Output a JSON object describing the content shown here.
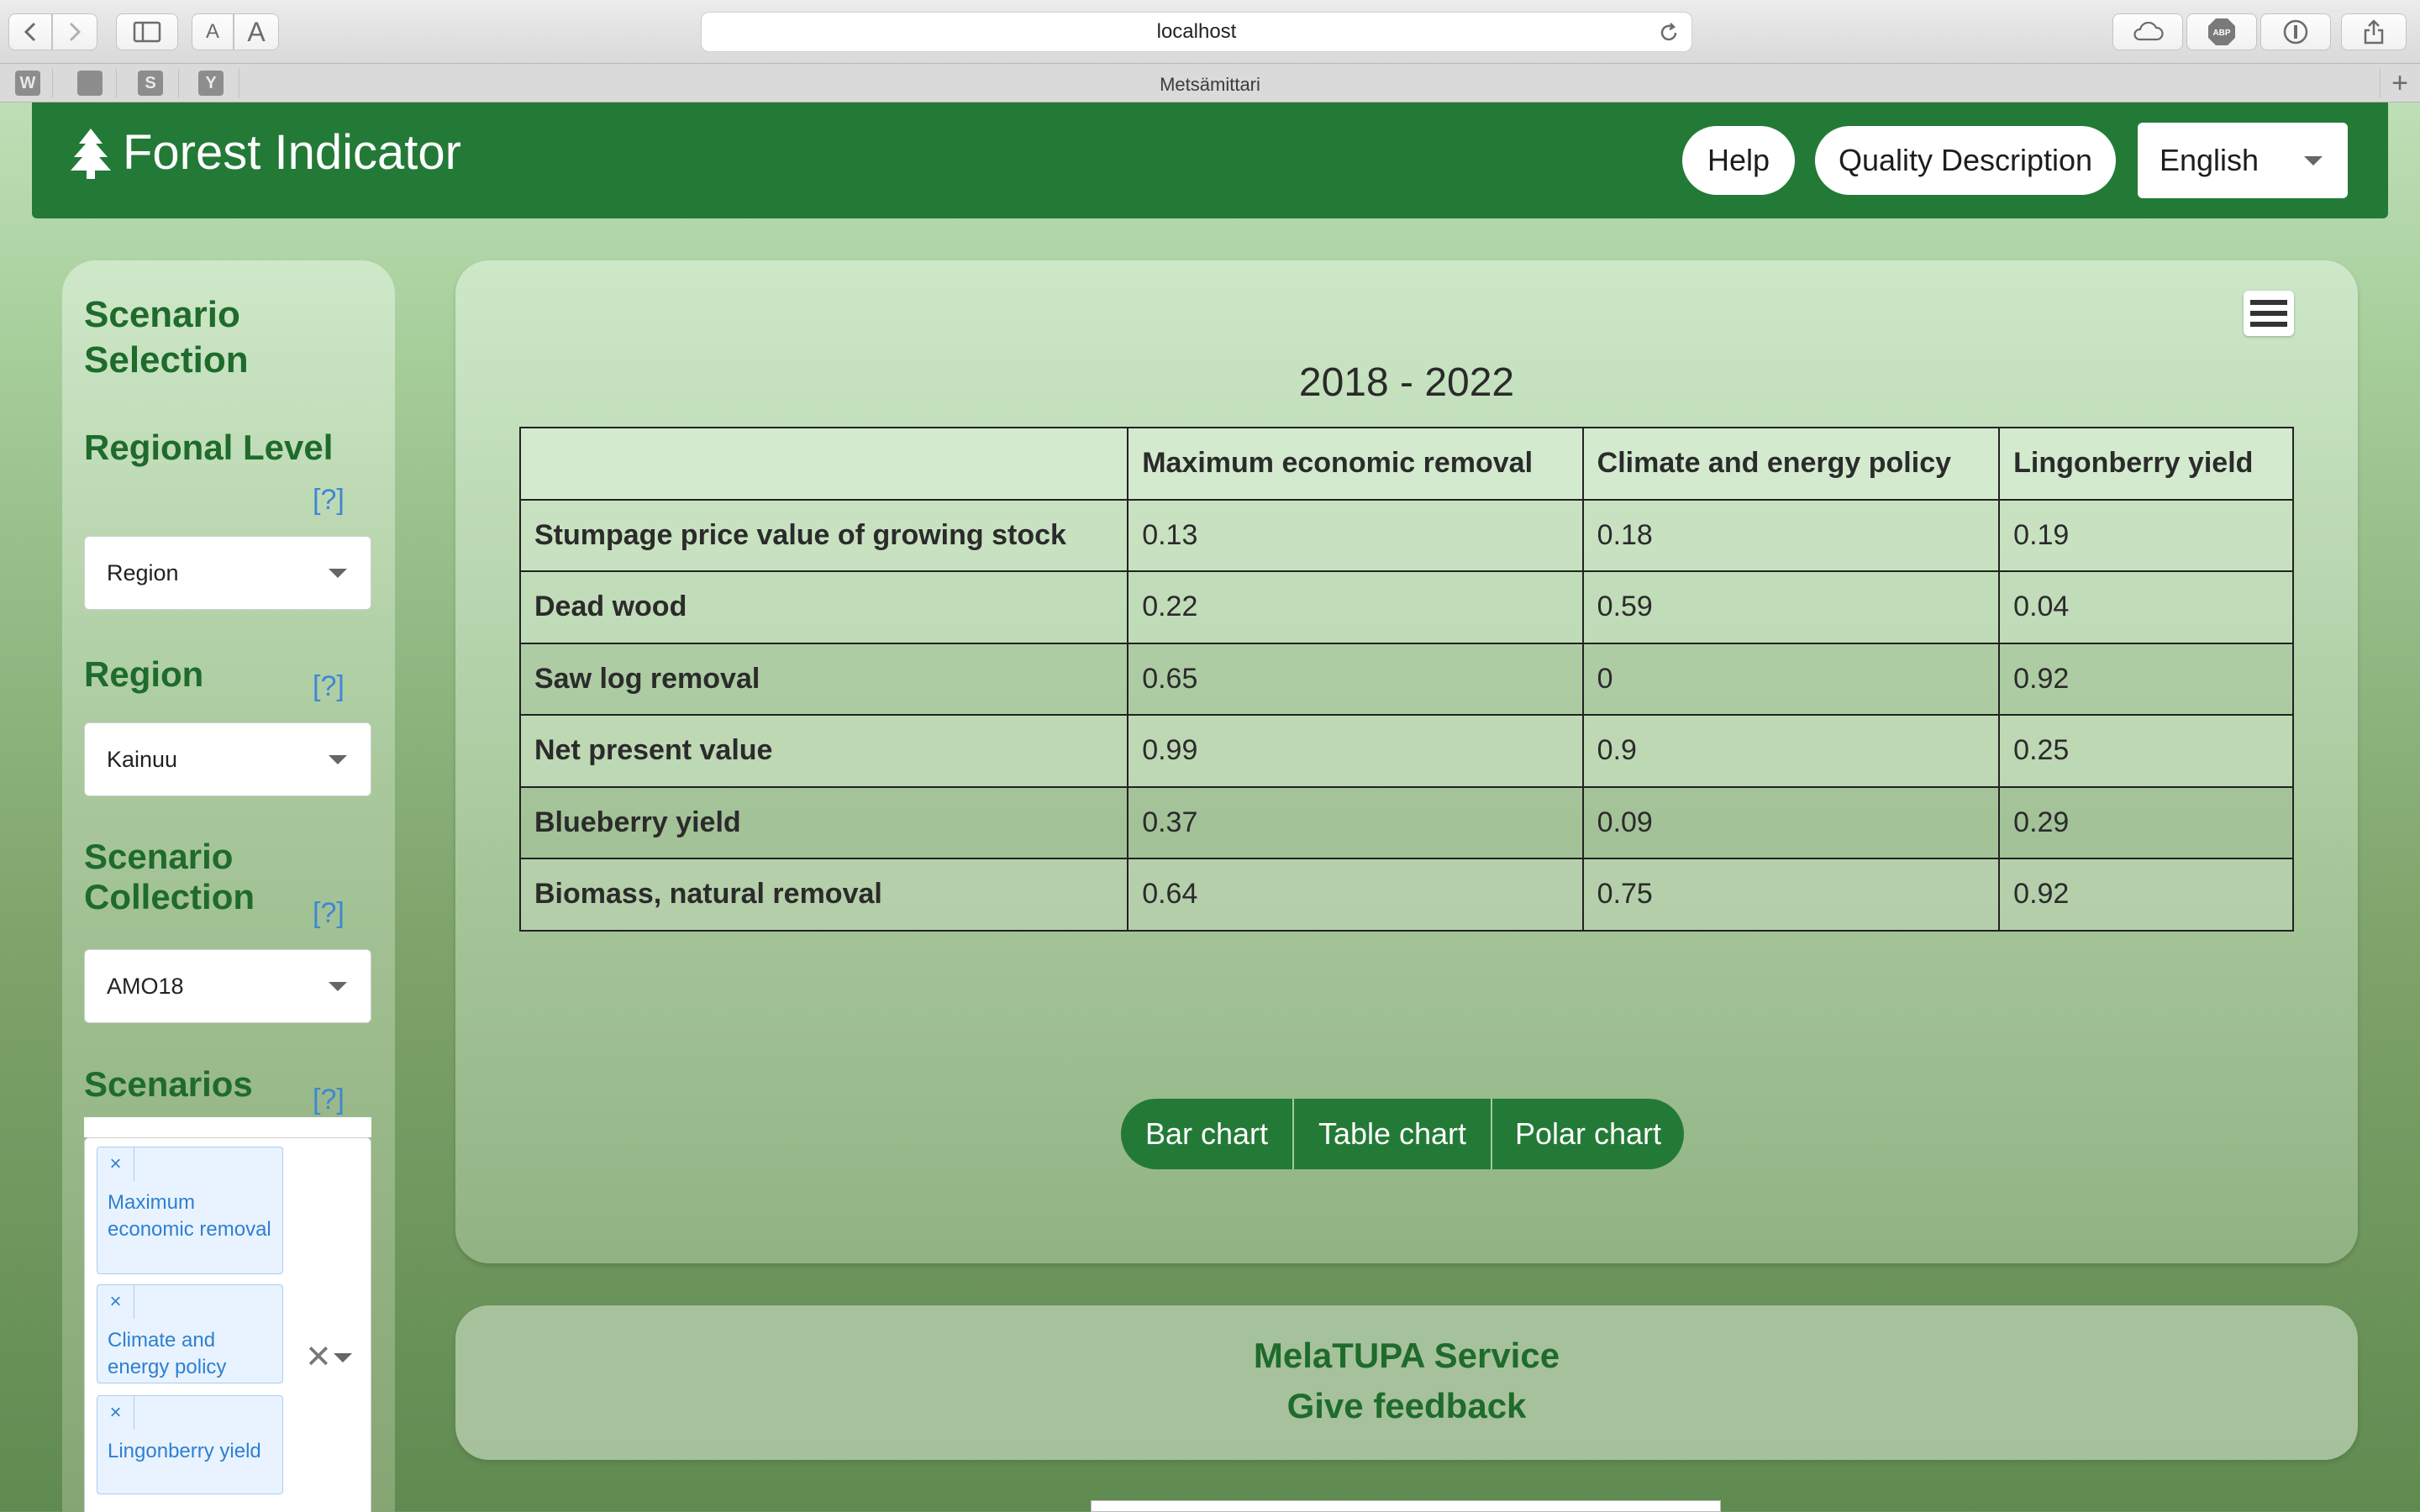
{
  "browser": {
    "address": "localhost",
    "tab_title": "Metsämittari",
    "favicons": [
      "W",
      "",
      "S",
      "Y"
    ],
    "font_size_small": "A",
    "font_size_large": "A",
    "adblock_label": "ABP"
  },
  "header": {
    "brand": "Forest Indicator",
    "help_label": "Help",
    "quality_label": "Quality Description",
    "language": "English",
    "brand_color": "#237a37"
  },
  "sidebar": {
    "title": "Scenario Selection",
    "regional_level": {
      "label": "Regional Level",
      "help": "[?]",
      "value": "Region"
    },
    "region": {
      "label": "Region",
      "help": "[?]",
      "value": "Kainuu"
    },
    "collection": {
      "label": "Scenario Collection",
      "help": "[?]",
      "value": "AMO18"
    },
    "scenarios": {
      "label": "Scenarios",
      "help": "[?]",
      "remove_symbol": "×",
      "clear_symbol": "✕",
      "selected": [
        "Maximum economic removal",
        "Climate and energy policy",
        "Lingonberry yield"
      ]
    }
  },
  "main": {
    "period": "2018 - 2022",
    "table": {
      "columns": [
        "",
        "Maximum economic removal",
        "Climate and energy policy",
        "Lingonberry yield"
      ],
      "rows": [
        [
          "Stumpage price value of growing stock",
          "0.13",
          "0.18",
          "0.19"
        ],
        [
          "Dead wood",
          "0.22",
          "0.59",
          "0.04"
        ],
        [
          "Saw log removal",
          "0.65",
          "0",
          "0.92"
        ],
        [
          "Net present value",
          "0.99",
          "0.9",
          "0.25"
        ],
        [
          "Blueberry yield",
          "0.37",
          "0.09",
          "0.29"
        ],
        [
          "Biomass, natural removal",
          "0.64",
          "0.75",
          "0.92"
        ]
      ]
    },
    "chart_buttons": [
      "Bar chart",
      "Table chart",
      "Polar chart"
    ]
  },
  "footer": {
    "service_link": "MelaTUPA Service",
    "feedback_link": "Give feedback"
  }
}
